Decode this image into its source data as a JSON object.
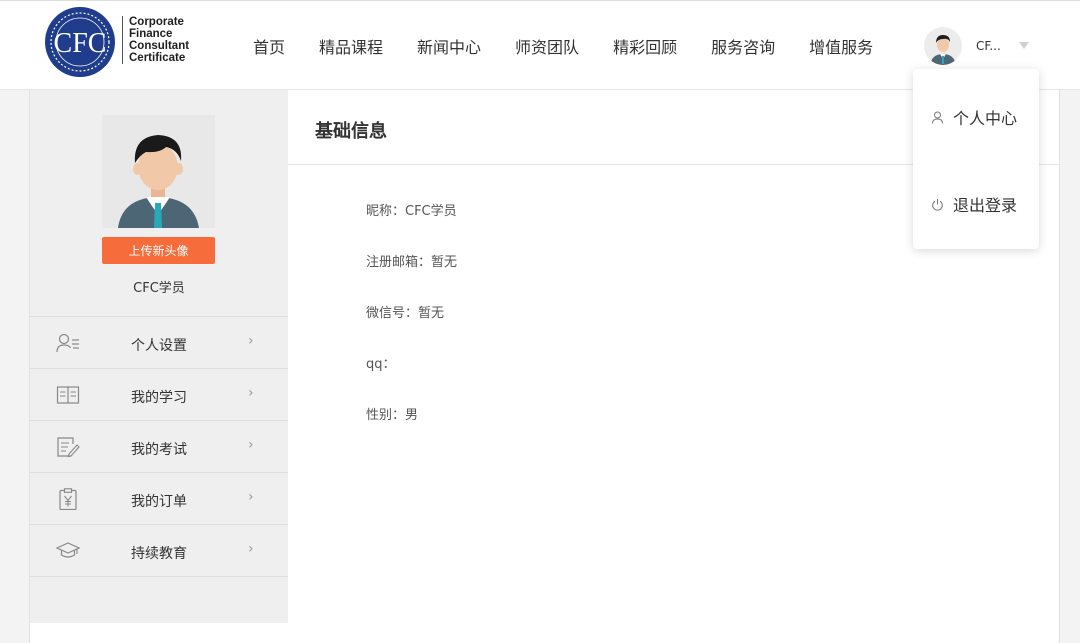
{
  "header": {
    "logo": {
      "seal_text": "CFC",
      "lines": [
        "Corporate",
        "Finance",
        "Consultant",
        "Certificate"
      ]
    },
    "nav": [
      {
        "label": "首页"
      },
      {
        "label": "精品课程"
      },
      {
        "label": "新闻中心"
      },
      {
        "label": "师资团队"
      },
      {
        "label": "精彩回顾"
      },
      {
        "label": "服务咨询"
      },
      {
        "label": "增值服务"
      }
    ],
    "user_name": "CF..."
  },
  "dropdown": {
    "items": [
      {
        "label": "个人中心",
        "icon": "user-icon"
      },
      {
        "label": "退出登录",
        "icon": "power-icon"
      }
    ]
  },
  "sidebar": {
    "upload_label": "上传新头像",
    "username": "CFC学员",
    "menu": [
      {
        "label": "个人设置",
        "icon": "profile-settings-icon"
      },
      {
        "label": "我的学习",
        "icon": "book-icon"
      },
      {
        "label": "我的考试",
        "icon": "exam-icon"
      },
      {
        "label": "我的订单",
        "icon": "order-icon"
      },
      {
        "label": "持续教育",
        "icon": "graduation-cap-icon"
      }
    ],
    "chevron": "›"
  },
  "content": {
    "title": "基础信息",
    "fields": [
      {
        "text": "昵称：CFC学员"
      },
      {
        "text": "注册邮箱：暂无"
      },
      {
        "text": "微信号：暂无"
      },
      {
        "text": "qq："
      },
      {
        "text": "性别：男"
      }
    ]
  },
  "colors": {
    "accent": "#f76c3b",
    "seal_blue": "#1f3d8c",
    "sidebar_bg": "#efefef"
  }
}
